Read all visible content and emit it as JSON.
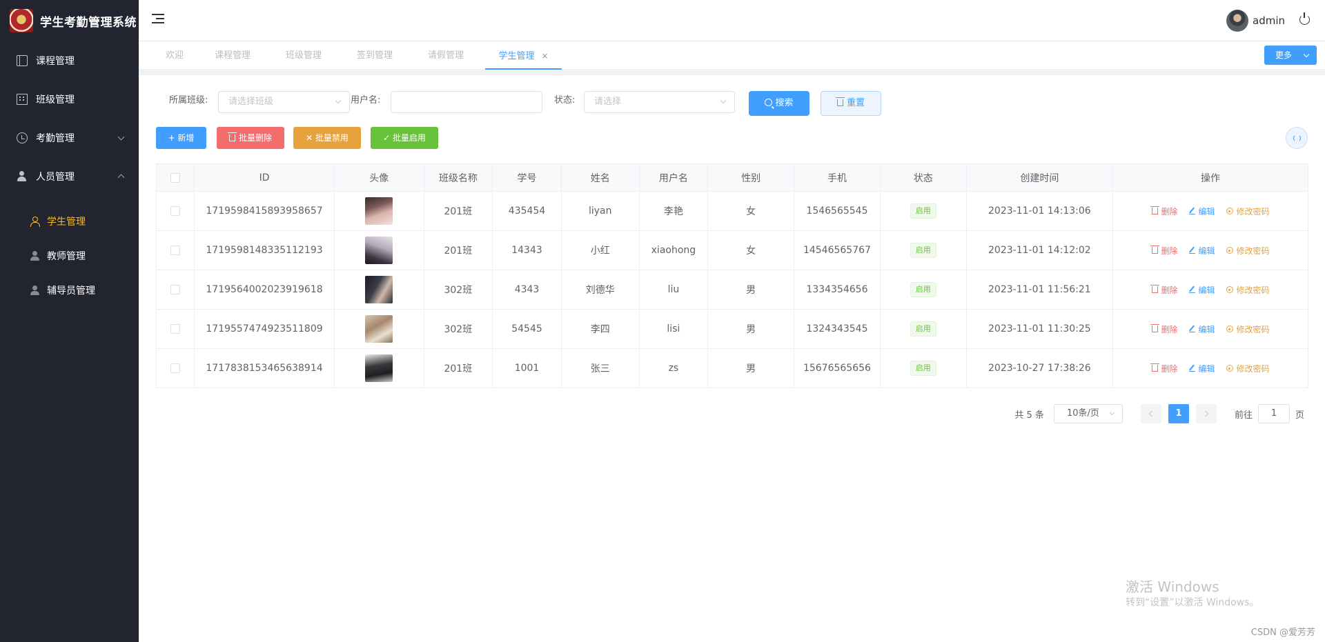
{
  "app": {
    "title": "学生考勤管理系统"
  },
  "sidebar": {
    "items": [
      {
        "label": "课程管理"
      },
      {
        "label": "班级管理"
      },
      {
        "label": "考勤管理"
      },
      {
        "label": "人员管理"
      }
    ],
    "subitems": [
      {
        "label": "学生管理"
      },
      {
        "label": "教师管理"
      },
      {
        "label": "辅导员管理"
      }
    ]
  },
  "header": {
    "username": "admin"
  },
  "tabs": [
    {
      "label": "欢迎"
    },
    {
      "label": "课程管理"
    },
    {
      "label": "班级管理"
    },
    {
      "label": "签到管理"
    },
    {
      "label": "请假管理"
    },
    {
      "label": "学生管理"
    }
  ],
  "tab_close": "×",
  "more_label": "更多",
  "filter": {
    "class_label": "所属班级:",
    "class_placeholder": "请选择班级",
    "username_label": "用户名:",
    "username_value": "",
    "status_label": "状态:",
    "status_placeholder": "请选择",
    "search_label": "搜索",
    "reset_label": "重置"
  },
  "toolbar": {
    "add_label": "+ 新增",
    "batch_delete_label": "批量删除",
    "batch_disable_label": "✕ 批量禁用",
    "batch_enable_label": "✓ 批量启用"
  },
  "table": {
    "headers": [
      "ID",
      "头像",
      "班级名称",
      "学号",
      "姓名",
      "用户名",
      "性别",
      "手机",
      "状态",
      "创建时间",
      "操作"
    ],
    "rows": [
      {
        "id": "1719598415893958657",
        "class": "201班",
        "student_no": "435454",
        "name": "liyan",
        "username": "李艳",
        "gender": "女",
        "phone": "1546565545",
        "status": "启用",
        "created": "2023-11-01 14:13:06"
      },
      {
        "id": "1719598148335112193",
        "class": "201班",
        "student_no": "14343",
        "name": "小红",
        "username": "xiaohong",
        "gender": "女",
        "phone": "14546565767",
        "status": "启用",
        "created": "2023-11-01 14:12:02"
      },
      {
        "id": "1719564002023919618",
        "class": "302班",
        "student_no": "4343",
        "name": "刘德华",
        "username": "liu",
        "gender": "男",
        "phone": "1334354656",
        "status": "启用",
        "created": "2023-11-01 11:56:21"
      },
      {
        "id": "1719557474923511809",
        "class": "302班",
        "student_no": "54545",
        "name": "李四",
        "username": "lisi",
        "gender": "男",
        "phone": "1324343545",
        "status": "启用",
        "created": "2023-11-01 11:30:25"
      },
      {
        "id": "1717838153465638914",
        "class": "201班",
        "student_no": "1001",
        "name": "张三",
        "username": "zs",
        "gender": "男",
        "phone": "15676565656",
        "status": "启用",
        "created": "2023-10-27 17:38:26"
      }
    ],
    "actions": {
      "delete": "删除",
      "edit": "编辑",
      "change_password": "修改密码"
    }
  },
  "pagination": {
    "total": "共 5 条",
    "page_size": "10条/页",
    "current_page": "1",
    "goto_prefix": "前往",
    "goto_value": "1",
    "goto_suffix": "页"
  },
  "watermark": {
    "line1": "激活 Windows",
    "line2": "转到“设置”以激活 Windows。",
    "csdn": "CSDN @爱芳芳"
  },
  "colors": {
    "primary": "#409eff",
    "danger": "#f56c6c",
    "warning": "#e6a23c",
    "success": "#67c23a",
    "sidebar_bg": "#222430",
    "active_menu": "#f7ba2a"
  }
}
